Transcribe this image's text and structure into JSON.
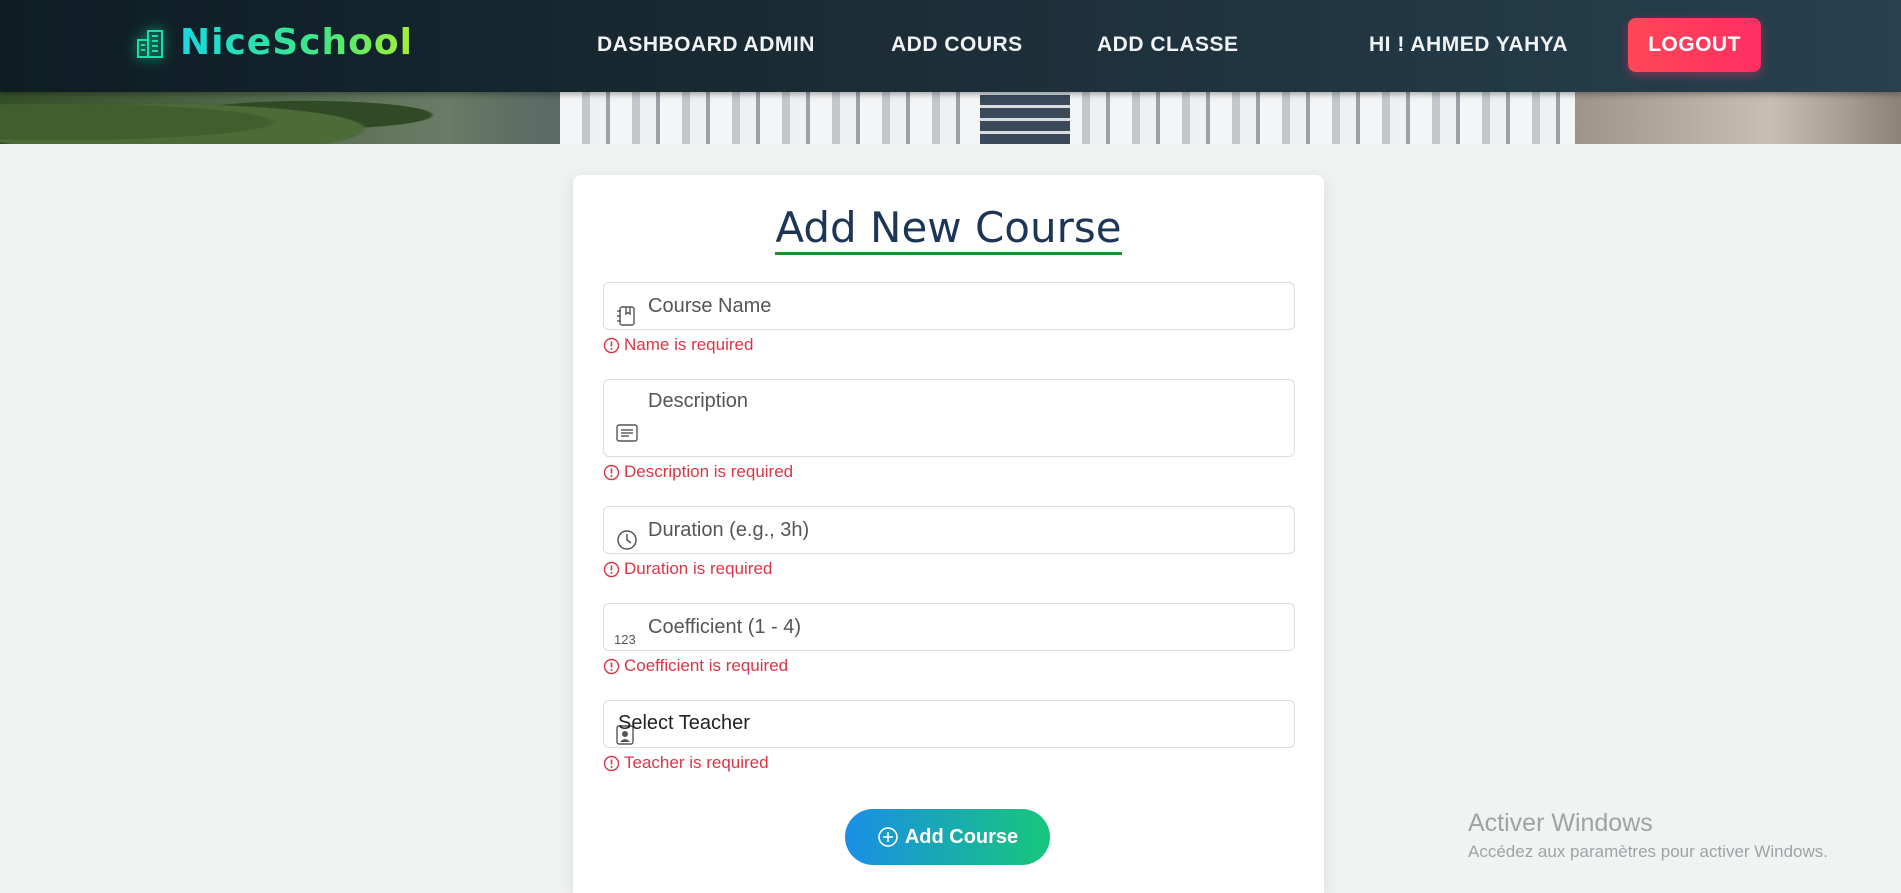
{
  "header": {
    "brand": "NiceSchool",
    "nav": {
      "dashboard": "DASHBOARD ADMIN",
      "add_cours": "ADD COURS",
      "add_classe": "ADD CLASSE"
    },
    "greeting": "HI ! AHMED YAHYA",
    "logout": "LOGOUT"
  },
  "form": {
    "title": "Add New Course",
    "fields": {
      "name": {
        "placeholder": "Course Name",
        "value": "",
        "error": "Name is required",
        "icon": "journal-icon"
      },
      "description": {
        "placeholder": "Description",
        "value": "",
        "error": "Description is required",
        "icon": "text-lines-icon"
      },
      "duration": {
        "placeholder": "Duration (e.g., 3h)",
        "value": "",
        "error": "Duration is required",
        "icon": "clock-icon"
      },
      "coefficient": {
        "placeholder": "Coefficient (1 - 4)",
        "value": "",
        "error": "Coefficient is required",
        "icon": "numbers-123-icon",
        "icon_text": "123"
      },
      "teacher": {
        "selected": "Select Teacher",
        "error": "Teacher is required",
        "icon": "person-badge-icon"
      }
    },
    "submit": "Add Course"
  },
  "watermark": {
    "title": "Activer Windows",
    "subtitle": "Accédez aux paramètres pour activer Windows."
  },
  "colors": {
    "accent_green": "#1e8c2a",
    "error": "#dc3545",
    "logout": "#ff2e63",
    "title": "#1d3557"
  }
}
